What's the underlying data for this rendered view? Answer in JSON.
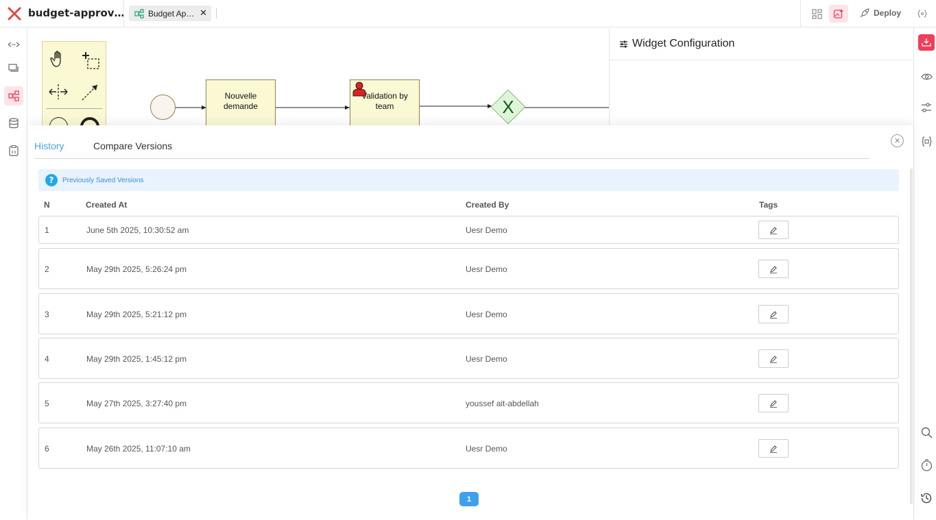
{
  "app": {
    "title": "budget-approv…"
  },
  "tabs": [
    {
      "label": "Budget Ap…"
    }
  ],
  "toolbar": {
    "deploy_label": "Deploy"
  },
  "canvas": {
    "tasks": [
      {
        "label_line1": "Nouvelle",
        "label_line2": "demande"
      },
      {
        "label_line1": "Validation by",
        "label_line2": "team"
      }
    ],
    "gateway_label": "X"
  },
  "widget": {
    "title": "Widget Configuration"
  },
  "panel": {
    "tabs": [
      {
        "label": "History"
      },
      {
        "label": "Compare Versions"
      }
    ],
    "info_text": "Previously Saved Versions",
    "info_icon": "?",
    "columns": {
      "n": "N",
      "created_at": "Created At",
      "created_by": "Created By",
      "tags": "Tags"
    },
    "rows": [
      {
        "n": "1",
        "created_at": "June 5th 2025, 10:30:52 am",
        "created_by": "Uesr Demo"
      },
      {
        "n": "2",
        "created_at": "May 29th 2025, 5:26:24 pm",
        "created_by": "Uesr Demo"
      },
      {
        "n": "3",
        "created_at": "May 29th 2025, 5:21:12 pm",
        "created_by": "Uesr Demo"
      },
      {
        "n": "4",
        "created_at": "May 29th 2025, 1:45:12 pm",
        "created_by": "Uesr Demo"
      },
      {
        "n": "5",
        "created_at": "May 27th 2025, 3:27:40 pm",
        "created_by": "youssef ait-abdellah"
      },
      {
        "n": "6",
        "created_at": "May 26th 2025, 11:07:10 am",
        "created_by": "Uesr Demo"
      }
    ],
    "pagination": {
      "current_page": "1"
    }
  },
  "colors": {
    "accent": "#ef3e5a",
    "link": "#4aa3df",
    "page_button": "#3fa0ee"
  }
}
